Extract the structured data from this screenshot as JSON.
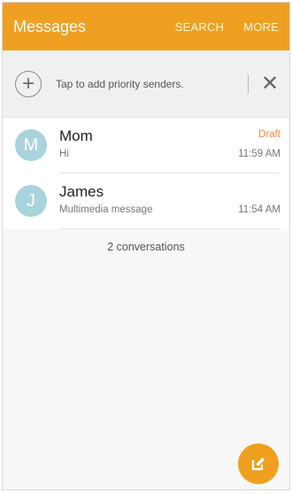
{
  "appbar": {
    "title": "Messages",
    "search_label": "SEARCH",
    "more_label": "MORE",
    "color": "#f0a020"
  },
  "priority_bar": {
    "add_icon": "plus-icon",
    "prompt": "Tap to add priority senders.",
    "close_icon": "close-icon"
  },
  "conversations": [
    {
      "initial": "M",
      "name": "Mom",
      "snippet": "Hi",
      "badge": "Draft",
      "time": "11:59 AM"
    },
    {
      "initial": "J",
      "name": "James",
      "snippet": "Multimedia message",
      "badge": "",
      "time": "11:54 AM"
    }
  ],
  "summary": {
    "count_text": "2 conversations"
  },
  "fab": {
    "icon": "compose-icon"
  }
}
